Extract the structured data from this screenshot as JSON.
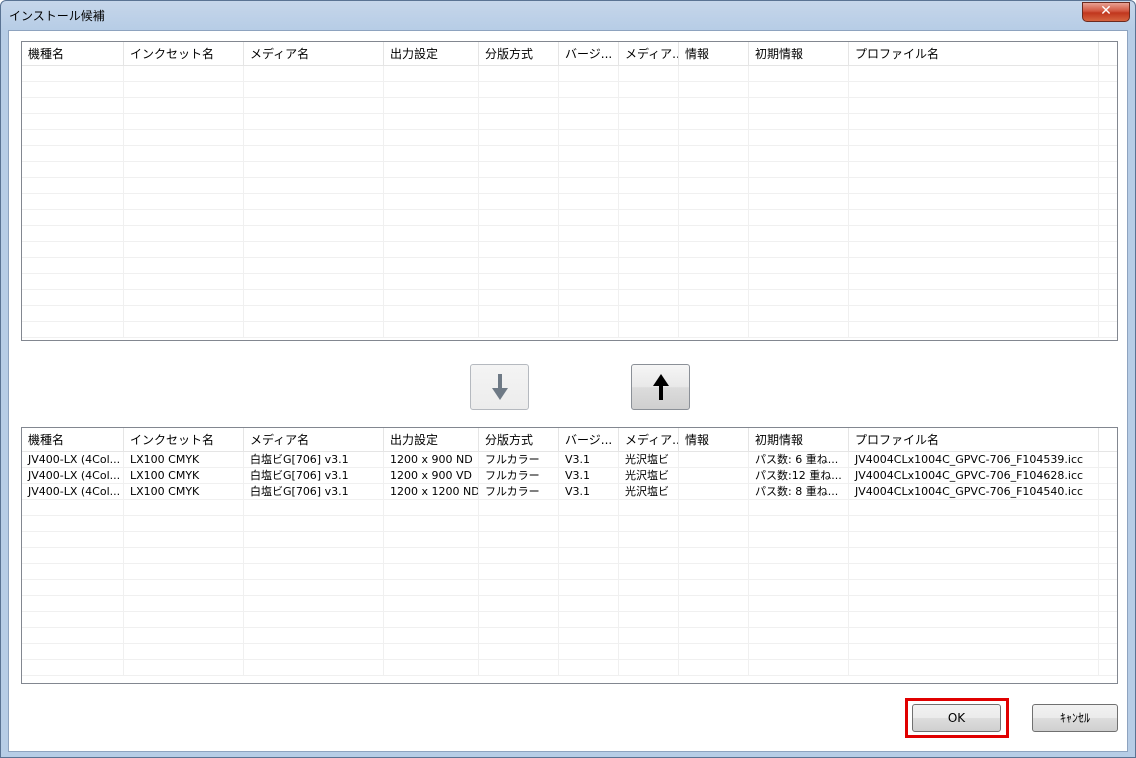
{
  "window": {
    "title": "インストール候補",
    "close_label": "✕"
  },
  "columns": [
    "機種名",
    "インクセット名",
    "メディア名",
    "出力設定",
    "分版方式",
    "バージ...",
    "メディア...",
    "情報",
    "初期情報",
    "プロファイル名"
  ],
  "top_list": {
    "rows": []
  },
  "bottom_list": {
    "rows": [
      [
        "JV400-LX (4Col...",
        "LX100 CMYK",
        "白塩ビG[706] v3.1",
        "1200 x 900 ND",
        "フルカラー",
        "V3.1",
        "光沢塩ビ",
        "",
        "パス数: 6  重ね...",
        "JV4004CLx1004C_GPVC-706_F104539.icc"
      ],
      [
        "JV400-LX (4Col...",
        "LX100 CMYK",
        "白塩ビG[706] v3.1",
        "1200 x 900 VD",
        "フルカラー",
        "V3.1",
        "光沢塩ビ",
        "",
        "パス数:12  重ね...",
        "JV4004CLx1004C_GPVC-706_F104628.icc"
      ],
      [
        "JV400-LX (4Col...",
        "LX100 CMYK",
        "白塩ビG[706] v3.1",
        "1200 x 1200 ND",
        "フルカラー",
        "V3.1",
        "光沢塩ビ",
        "",
        "パス数: 8  重ね...",
        "JV4004CLx1004C_GPVC-706_F104540.icc"
      ]
    ]
  },
  "buttons": {
    "move_down": "down-arrow-icon",
    "move_up": "up-arrow-icon",
    "ok": "OK",
    "cancel": "ｷｬﾝｾﾙ"
  }
}
